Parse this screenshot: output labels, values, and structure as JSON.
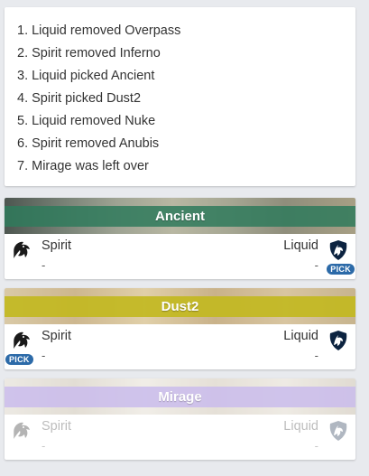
{
  "veto_steps": [
    "1. Liquid removed Overpass",
    "2. Spirit removed Inferno",
    "3. Liquid picked Ancient",
    "4. Spirit picked Dust2",
    "5. Liquid removed Nuke",
    "6. Spirit removed Anubis",
    "7. Mirage was left over"
  ],
  "maps": [
    {
      "name": "Ancient",
      "band_color": "#2f7a5c",
      "team_left": {
        "name": "Spirit",
        "score": "-",
        "logo_icon": "spirit-dragon-icon"
      },
      "team_right": {
        "name": "Liquid",
        "score": "-",
        "logo_icon": "liquid-horse-icon",
        "pick_label": "PICK"
      }
    },
    {
      "name": "Dust2",
      "band_color": "#c2b81e",
      "team_left": {
        "name": "Spirit",
        "score": "-",
        "logo_icon": "spirit-dragon-icon",
        "pick_label": "PICK"
      },
      "team_right": {
        "name": "Liquid",
        "score": "-",
        "logo_icon": "liquid-horse-icon"
      }
    },
    {
      "name": "Mirage",
      "band_color": "#b9a6e6",
      "team_left": {
        "name": "Spirit",
        "score": "-",
        "logo_icon": "spirit-dragon-icon"
      },
      "team_right": {
        "name": "Liquid",
        "score": "-",
        "logo_icon": "liquid-horse-icon"
      }
    }
  ],
  "colors": {
    "pick_badge": "#2c6aa8",
    "page_bg": "#e8eaee"
  }
}
